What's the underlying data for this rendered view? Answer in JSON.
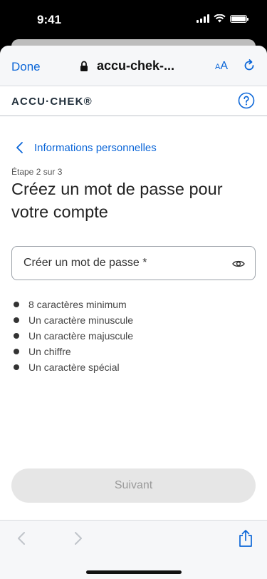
{
  "status_bar": {
    "time": "9:41"
  },
  "browser": {
    "done_label": "Done",
    "url": "accu-chek-...",
    "aa_small": "A",
    "aa_large": "A"
  },
  "site": {
    "logo": "ACCU·CHEK®"
  },
  "page": {
    "back_label": "Informations personnelles",
    "step": "Étape 2 sur 3",
    "title": "Créez un mot de passe pour votre compte",
    "password_placeholder": "Créer un mot de passe *",
    "rules": [
      "8 caractères minimum",
      "Un caractère minuscule",
      "Un caractère majuscule",
      "Un chiffre",
      "Un caractère spécial"
    ],
    "next_label": "Suivant"
  },
  "colors": {
    "link": "#0b66d8",
    "button_disabled_bg": "#e6e6e6",
    "button_disabled_text": "#9a9a9a"
  },
  "icons": [
    "lock-icon",
    "reload-icon",
    "help-icon",
    "chevron-left-icon",
    "eye-icon",
    "back-arrow-icon",
    "forward-arrow-icon",
    "share-icon"
  ]
}
